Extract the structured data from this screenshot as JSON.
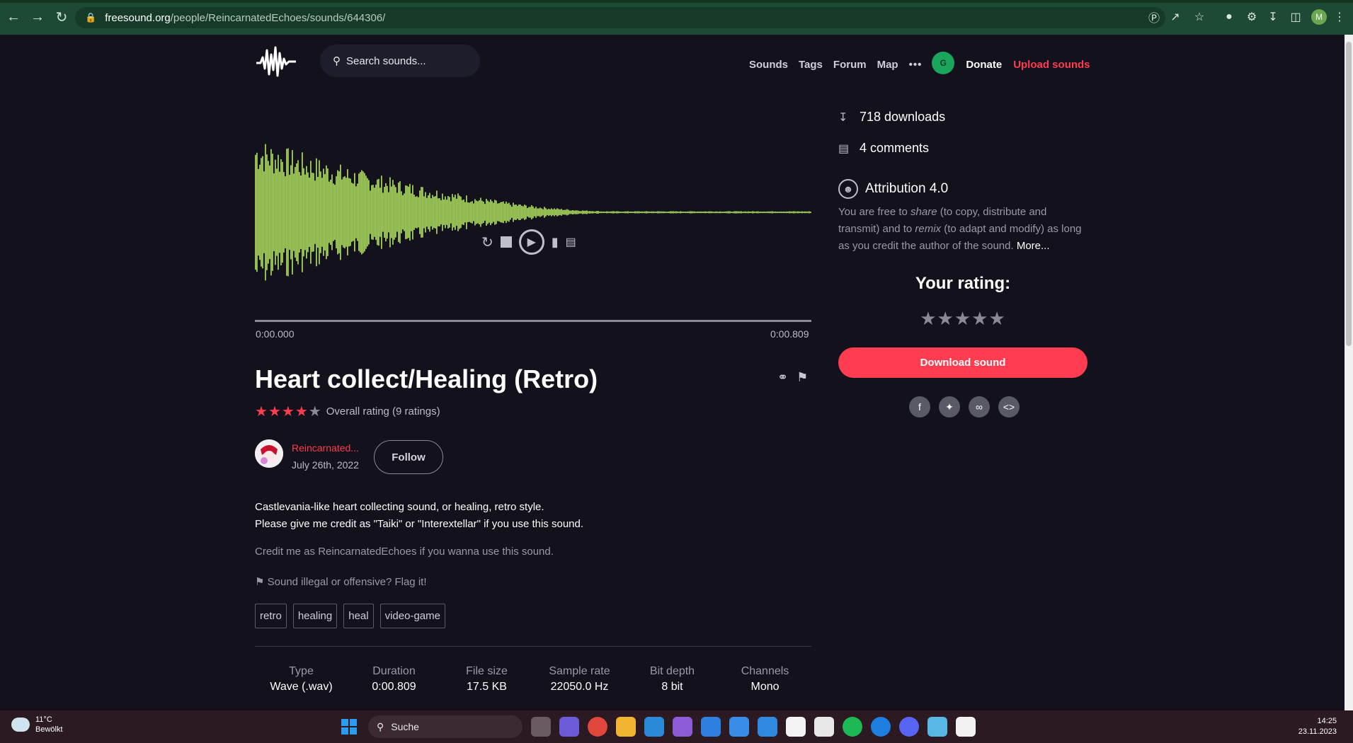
{
  "browser": {
    "url_host": "freesound.org",
    "url_path": "/people/ReincarnatedEchoes/sounds/644306/",
    "profile_initial": "M"
  },
  "site": {
    "search_placeholder": "Search sounds...",
    "nav": [
      "Sounds",
      "Tags",
      "Forum",
      "Map"
    ],
    "more_label": "•••",
    "user_initial": "G",
    "donate_label": "Donate",
    "upload_label": "Upload sounds"
  },
  "player": {
    "time_start": "0:00.000",
    "time_end": "0:00.809"
  },
  "sound": {
    "title": "Heart collect/Healing (Retro)",
    "rating_value": 4,
    "rating_max": 5,
    "rating_text": "Overall rating (9 ratings)",
    "author": "Reincarnated...",
    "date": "July 26th, 2022",
    "follow_label": "Follow",
    "description_line1": "Castlevania-like heart collecting sound, or healing, retro style.",
    "description_line2": "Please give me credit as \"Taiki\" or \"Interextellar\" if you use this sound.",
    "credit_note": "Credit me as ReincarnatedEchoes if you wanna use this sound.",
    "flag_text": "Sound illegal or offensive? Flag it!",
    "tags": [
      "retro",
      "healing",
      "heal",
      "video-game"
    ],
    "meta": [
      {
        "label": "Type",
        "value": "Wave (.wav)"
      },
      {
        "label": "Duration",
        "value": "0:00.809"
      },
      {
        "label": "File size",
        "value": "17.5 KB"
      },
      {
        "label": "Sample rate",
        "value": "22050.0 Hz"
      },
      {
        "label": "Bit depth",
        "value": "8 bit"
      },
      {
        "label": "Channels",
        "value": "Mono"
      }
    ]
  },
  "sidebar": {
    "downloads": "718 downloads",
    "comments": "4 comments",
    "license_title": "Attribution 4.0",
    "license_text_1": "You are free to ",
    "license_share": "share",
    "license_text_2": " (to copy, distribute and transmit) and to ",
    "license_remix": "remix",
    "license_text_3": " (to adapt and modify) as long as you credit the author of the sound. ",
    "license_more": "More...",
    "your_rating_label": "Your rating:",
    "download_label": "Download sound"
  },
  "taskbar": {
    "temperature": "11°C",
    "weather": "Bewölkt",
    "search_label": "Suche",
    "time": "14:25",
    "date": "23.11.2023"
  }
}
